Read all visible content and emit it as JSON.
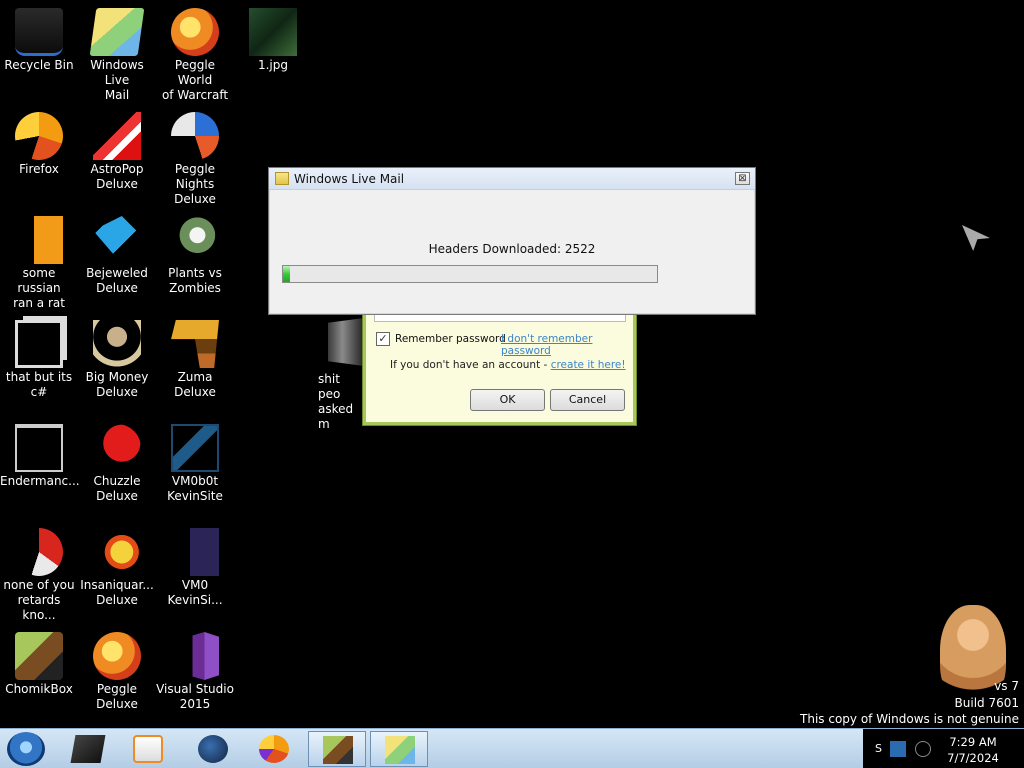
{
  "desktop": {
    "icons": [
      {
        "label": "Recycle Bin",
        "icon": "recycle-bin-icon"
      },
      {
        "label": "Windows Live\nMail",
        "icon": "windows-live-mail-icon"
      },
      {
        "label": "Peggle World\nof Warcraft ...",
        "icon": "peggle-icon"
      },
      {
        "label": "1.jpg",
        "icon": "image-file-icon"
      },
      {
        "label": "Firefox",
        "icon": "firefox-icon"
      },
      {
        "label": "AstroPop\nDeluxe",
        "icon": "astropop-icon"
      },
      {
        "label": "Peggle Nights\nDeluxe",
        "icon": "peggle-nights-icon"
      },
      {
        "label": "some russian\nran a rat",
        "icon": "internet-explorer-icon"
      },
      {
        "label": "Bejeweled\nDeluxe",
        "icon": "bejeweled-icon"
      },
      {
        "label": "Plants vs\nZombies",
        "icon": "plants-vs-zombies-icon"
      },
      {
        "label": "that but its c#",
        "icon": "folder-shortcut-icon"
      },
      {
        "label": "Big Money\nDeluxe",
        "icon": "big-money-icon"
      },
      {
        "label": "Zuma Deluxe",
        "icon": "zuma-icon"
      },
      {
        "label": "Endermanc...",
        "icon": "application-icon"
      },
      {
        "label": "Chuzzle\nDeluxe",
        "icon": "chuzzle-icon"
      },
      {
        "label": "VM0b0t\nKevinSite",
        "icon": "vm-icon"
      },
      {
        "label": "none of you\nretards kno...",
        "icon": "chrome-icon"
      },
      {
        "label": "Insaniquar...\nDeluxe",
        "icon": "insaniquarium-icon"
      },
      {
        "label": "VM0\nKevinSi...",
        "icon": "vm0-icon"
      },
      {
        "label": "ChomikBox",
        "icon": "chomikbox-icon"
      },
      {
        "label": "Peggle Deluxe",
        "icon": "peggle-deluxe-icon"
      },
      {
        "label": "Visual Studio\n2015",
        "icon": "visual-studio-icon"
      }
    ],
    "partial_icon_label": "shit peo\nasked m"
  },
  "login": {
    "remember_label": "Remember password",
    "remember_checked": true,
    "forgot_link": "I don't remember password",
    "no_account_text": "If you don't have an account -",
    "create_link": "create it here!",
    "ok_label": "OK",
    "cancel_label": "Cancel"
  },
  "dialog": {
    "title": "Windows Live Mail",
    "status_text": "Headers Downloaded: 2522",
    "progress": 0.02,
    "close_glyph": "⊠"
  },
  "watermark": {
    "line1": "vs 7",
    "line2": "Build 7601",
    "line3": "This copy of Windows is not genuine"
  },
  "taskbar": {
    "time": "7:29 AM",
    "date": "7/7/2024",
    "tray_label": "S"
  }
}
